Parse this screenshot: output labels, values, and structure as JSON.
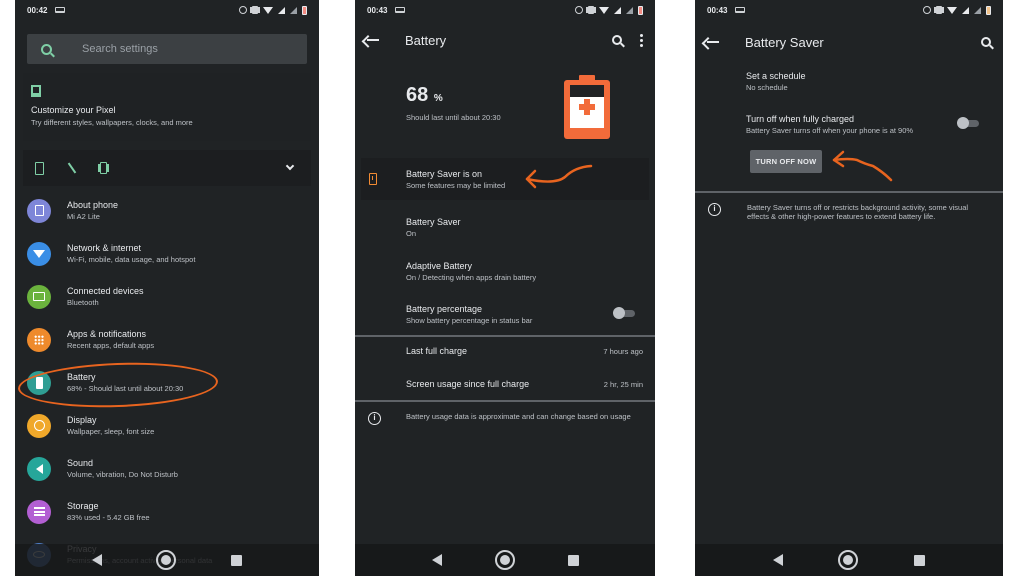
{
  "screen1": {
    "status": {
      "time": "00:42"
    },
    "search": {
      "placeholder": "Search settings"
    },
    "customize": {
      "title": "Customize your Pixel",
      "subtitle": "Try different styles, wallpapers, clocks, and more"
    },
    "condition_icons": [
      "battery-saver-icon",
      "flashlight-off-icon",
      "vibrate-icon"
    ],
    "items": [
      {
        "title": "About phone",
        "subtitle": "Mi A2 Lite",
        "icon": "phone-info-icon",
        "color": "#7e86d8"
      },
      {
        "title": "Network & internet",
        "subtitle": "Wi-Fi, mobile, data usage, and hotspot",
        "icon": "wifi-icon",
        "color": "#3a8ee6"
      },
      {
        "title": "Connected devices",
        "subtitle": "Bluetooth",
        "icon": "devices-icon",
        "color": "#6bb33d"
      },
      {
        "title": "Apps & notifications",
        "subtitle": "Recent apps, default apps",
        "icon": "apps-icon",
        "color": "#ee8a2c"
      },
      {
        "title": "Battery",
        "subtitle": "68% - Should last until about 20:30",
        "icon": "battery-icon",
        "color": "#2f9e93"
      },
      {
        "title": "Display",
        "subtitle": "Wallpaper, sleep, font size",
        "icon": "brightness-icon",
        "color": "#f0a82a"
      },
      {
        "title": "Sound",
        "subtitle": "Volume, vibration, Do Not Disturb",
        "icon": "volume-icon",
        "color": "#26a69a"
      },
      {
        "title": "Storage",
        "subtitle": "83% used - 5.42 GB free",
        "icon": "storage-icon",
        "color": "#b35fd3"
      },
      {
        "title": "Privacy",
        "subtitle": "Permissions, account activity, personal data",
        "icon": "privacy-icon",
        "color": "#4f7fc9"
      }
    ]
  },
  "screen2": {
    "status": {
      "time": "00:43"
    },
    "title": "Battery",
    "battery_percent": "68",
    "percent_sign": "%",
    "estimate": "Should last until about 20:30",
    "accent": "#f26b3a",
    "banner": {
      "title": "Battery Saver is on",
      "subtitle": "Some features may be limited"
    },
    "rows": [
      {
        "title": "Battery Saver",
        "subtitle": "On"
      },
      {
        "title": "Adaptive Battery",
        "subtitle": "On / Detecting when apps drain battery"
      },
      {
        "title": "Battery percentage",
        "subtitle": "Show battery percentage in status bar",
        "toggle": false
      }
    ],
    "stats": [
      {
        "label": "Last full charge",
        "value": "7 hours ago"
      },
      {
        "label": "Screen usage since full charge",
        "value": "2 hr, 25 min"
      }
    ],
    "info": "Battery usage data is approximate and can change based on usage"
  },
  "screen3": {
    "status": {
      "time": "00:43"
    },
    "title": "Battery Saver",
    "schedule": {
      "title": "Set a schedule",
      "subtitle": "No schedule"
    },
    "auto_off": {
      "title": "Turn off when fully charged",
      "subtitle": "Battery Saver turns off when your phone is at 90%",
      "toggle": false
    },
    "button": "TURN OFF NOW",
    "info": "Battery Saver turns off or restricts background activity, some visual effects & other high-power features to extend battery life."
  },
  "annotation_color": "#e8641f"
}
